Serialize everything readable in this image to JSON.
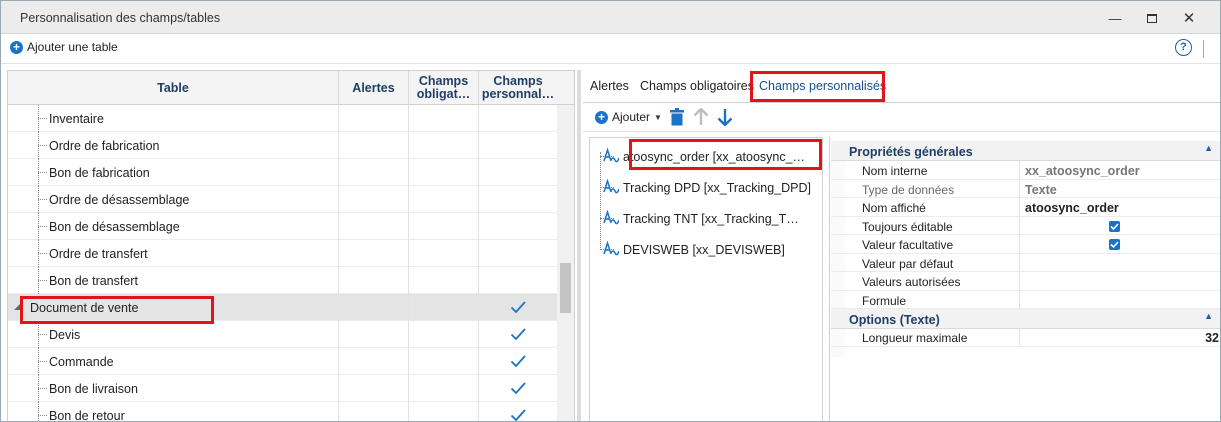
{
  "window": {
    "title": "Personnalisation des champs/tables",
    "controls": [
      "minimize-icon",
      "maximize-icon",
      "close-icon"
    ]
  },
  "toolbar": {
    "add_table_label": "Ajouter une table",
    "help_glyph": "?"
  },
  "grid": {
    "headers": {
      "table": "Table",
      "alertes": "Alertes",
      "champs_obligatoires": "Champs obligat…",
      "champs_personnalises": "Champs personnal…"
    },
    "rows": [
      {
        "label": "Inventaire",
        "child": true,
        "checked": false
      },
      {
        "label": "Ordre de fabrication",
        "child": true,
        "checked": false
      },
      {
        "label": "Bon de fabrication",
        "child": true,
        "checked": false
      },
      {
        "label": "Ordre de désassemblage",
        "child": true,
        "checked": false
      },
      {
        "label": "Bon de désassemblage",
        "child": true,
        "checked": false
      },
      {
        "label": "Ordre de transfert",
        "child": true,
        "checked": false
      },
      {
        "label": "Bon de transfert",
        "child": true,
        "checked": false
      },
      {
        "label": "Document de vente",
        "child": false,
        "checked": true,
        "selected": true
      },
      {
        "label": "Devis",
        "child": true,
        "checked": true
      },
      {
        "label": "Commande",
        "child": true,
        "checked": true
      },
      {
        "label": "Bon de livraison",
        "child": true,
        "checked": true
      },
      {
        "label": "Bon de retour",
        "child": true,
        "checked": true
      }
    ]
  },
  "tabs": [
    {
      "label": "Alertes",
      "active": false
    },
    {
      "label": "Champs obligatoires",
      "active": false
    },
    {
      "label": "Champs personnalisés",
      "active": true
    }
  ],
  "fields_toolbar": {
    "add_label": "Ajouter"
  },
  "fields": [
    {
      "label": "atoosync_order [xx_atoosync_…",
      "selected": true
    },
    {
      "label": "Tracking DPD [xx_Tracking_DPD]"
    },
    {
      "label": "Tracking TNT [xx_Tracking_T…"
    },
    {
      "label": "DEVISWEB [xx_DEVISWEB]"
    }
  ],
  "properties": {
    "general_title": "Propriétés générales",
    "general": [
      {
        "name": "Nom interne",
        "value": "xx_atoosync_order",
        "style": "grey",
        "muted": false
      },
      {
        "name": "Type de données",
        "value": "Texte",
        "style": "grey",
        "muted": true
      },
      {
        "name": "Nom affiché",
        "value": "atoosync_order",
        "style": "bold",
        "muted": false
      },
      {
        "name": "Toujours éditable",
        "checkbox": true
      },
      {
        "name": "Valeur facultative",
        "checkbox": true
      },
      {
        "name": "Valeur par défaut",
        "value": ""
      },
      {
        "name": "Valeurs autorisées",
        "value": ""
      },
      {
        "name": "Formule",
        "value": ""
      }
    ],
    "options_title": "Options (Texte)",
    "options": [
      {
        "name": "Longueur maximale",
        "value": "32"
      }
    ]
  },
  "colors": {
    "accent": "#1a73c7",
    "highlight_border": "#e0141b",
    "header_text": "#1f3e69"
  }
}
